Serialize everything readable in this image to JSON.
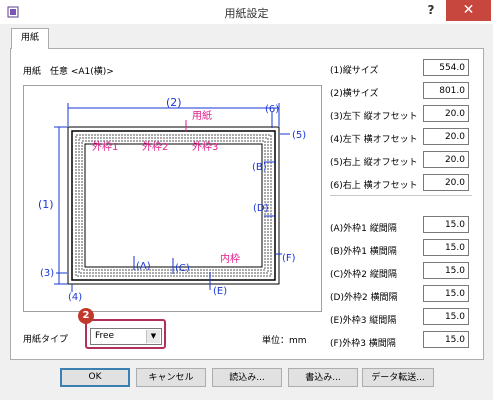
{
  "window": {
    "title": "用紙設定",
    "help": "?",
    "close": "✕"
  },
  "tab": {
    "label": "用紙"
  },
  "paper_label": "用紙　任意 <A1(横)>",
  "diagram": {
    "labels": {
      "d1": "(1)",
      "d2": "(2)",
      "d3": "(3)",
      "d4": "(4)",
      "d5": "(5)",
      "d6": "(6)",
      "a": "(A)",
      "b": "(B)",
      "c": "(C)",
      "d": "(D)",
      "e": "(E)",
      "f": "(F)",
      "youshi": "用紙",
      "gaiwaku1": "外枠1",
      "gaiwaku2": "外枠2",
      "gaiwaku3": "外枠3",
      "naiwaku": "内枠"
    }
  },
  "settings_top": [
    {
      "label": "(1)縦サイズ",
      "value": "554.0"
    },
    {
      "label": "(2)横サイズ",
      "value": "801.0"
    },
    {
      "label": "(3)左下 縦オフセット",
      "value": "20.0"
    },
    {
      "label": "(4)左下 横オフセット",
      "value": "20.0"
    },
    {
      "label": "(5)右上 縦オフセット",
      "value": "20.0"
    },
    {
      "label": "(6)右上 横オフセット",
      "value": "20.0"
    }
  ],
  "settings_bottom": [
    {
      "label": "(A)外枠1 縦間隔",
      "value": "15.0"
    },
    {
      "label": "(B)外枠1 横間隔",
      "value": "15.0"
    },
    {
      "label": "(C)外枠2 縦間隔",
      "value": "15.0"
    },
    {
      "label": "(D)外枠2 横間隔",
      "value": "15.0"
    },
    {
      "label": "(E)外枠3 縦間隔",
      "value": "15.0"
    },
    {
      "label": "(F)外枠3 横間隔",
      "value": "15.0"
    }
  ],
  "paper_type": {
    "label": "用紙タイプ",
    "value": "Free",
    "step_badge": "2"
  },
  "unit": "単位：mm",
  "buttons": {
    "ok": "OK",
    "cancel": "キャンセル",
    "load": "読込み...",
    "save": "書込み...",
    "transfer": "データ転送..."
  }
}
